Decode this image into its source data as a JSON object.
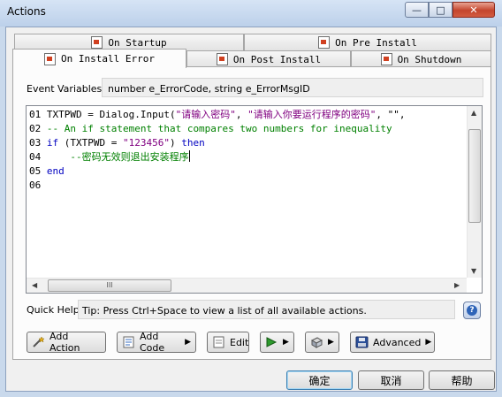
{
  "window": {
    "title": "Actions",
    "min_glyph": "—",
    "max_glyph": "□",
    "close_glyph": "✕"
  },
  "tabs": [
    {
      "label": "On Startup",
      "active": false
    },
    {
      "label": "On Pre Install",
      "active": false
    },
    {
      "label": "On Install Error",
      "active": true
    },
    {
      "label": "On Post Install",
      "active": false
    },
    {
      "label": "On Shutdown",
      "active": false
    }
  ],
  "event_variables": {
    "label": "Event Variables:",
    "value": "number e_ErrorCode, string e_ErrorMsgID"
  },
  "editor": {
    "lines": [
      {
        "num": "01",
        "p1": "TXTPWD = Dialog.Input(",
        "s1": "\"请输入密码\"",
        "p2": ", ",
        "s2": "\"请输入你要运行程序的密码\"",
        "p3": ", \"\", "
      },
      {
        "num": "02",
        "comment": "-- An if statement that compares two numbers for inequality"
      },
      {
        "num": "03",
        "kw1": "if",
        "p1": " (TXTPWD = ",
        "s1": "\"123456\"",
        "p2": ") ",
        "kw2": "then"
      },
      {
        "num": "04",
        "indent": "    ",
        "comment": "--密码无效则退出安装程序"
      },
      {
        "num": "05",
        "kw1": "end"
      },
      {
        "num": "06"
      }
    ],
    "hscroll_grip": "III"
  },
  "quick_help": {
    "label": "Quick Help:",
    "text": "Tip: Press Ctrl+Space to view a list of all available actions."
  },
  "toolbar": {
    "add_action": "Add Action",
    "add_code": "Add Code",
    "edit": "Edit",
    "advanced": "Advanced"
  },
  "footer": {
    "ok": "确定",
    "cancel": "取消",
    "help": "帮助"
  }
}
